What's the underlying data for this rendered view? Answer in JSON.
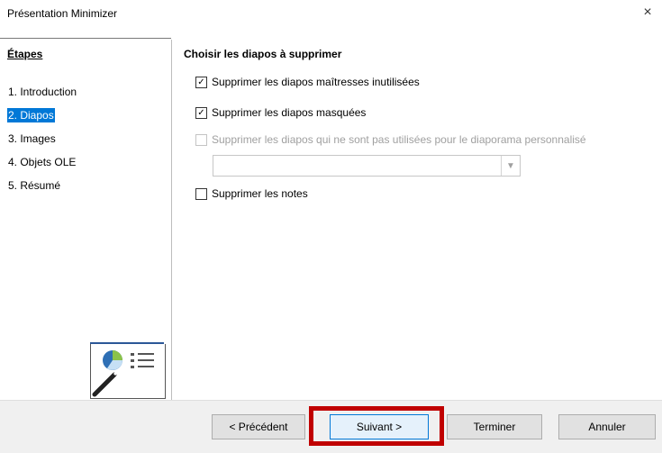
{
  "window": {
    "title": "Présentation Minimizer",
    "close_glyph": "×"
  },
  "sidebar": {
    "title": "Étapes",
    "steps": [
      {
        "label": "1. Introduction",
        "selected": false
      },
      {
        "label": "2. Diapos",
        "selected": true
      },
      {
        "label": "3. Images",
        "selected": false
      },
      {
        "label": "4. Objets OLE",
        "selected": false
      },
      {
        "label": "5. Résumé",
        "selected": false
      }
    ]
  },
  "main": {
    "title": "Choisir les diapos à supprimer",
    "options": [
      {
        "label": "Supprimer les diapos maîtresses inutilisées",
        "checked": true,
        "enabled": true
      },
      {
        "label": "Supprimer les diapos masquées",
        "checked": true,
        "enabled": true
      },
      {
        "label": "Supprimer les diapos qui ne sont pas utilisées pour le diaporama personnalisé",
        "checked": false,
        "enabled": false
      },
      {
        "label": "Supprimer les notes",
        "checked": false,
        "enabled": true
      }
    ],
    "combo_value": ""
  },
  "buttons": {
    "prev": "< Précédent",
    "next": "Suivant >",
    "finish": "Terminer",
    "cancel": "Annuler"
  },
  "colors": {
    "selection": "#0078d7",
    "highlight": "#c00000"
  }
}
